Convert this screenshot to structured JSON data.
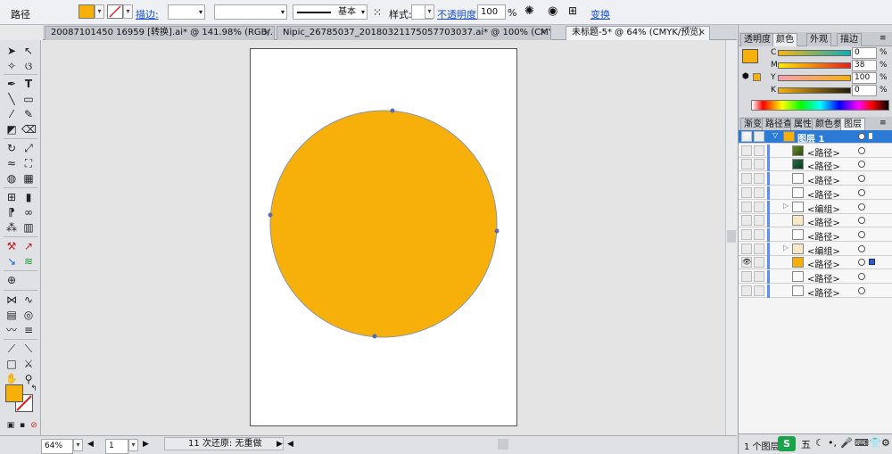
{
  "colors": {
    "fill": "#f7b00a",
    "accent": "#2a7ad6",
    "selection": "#2f59c6"
  },
  "control_bar": {
    "object_type": "路径",
    "stroke_label": "描边:",
    "stroke_profile": "基本",
    "style_label": "样式:",
    "opacity_label": "不透明度:",
    "opacity_value": "100",
    "opacity_unit": "%",
    "transform_label": "变换"
  },
  "tabs": [
    {
      "label": "20087101450 16959 [转换].ai* @ 141.98% (RGB/...",
      "close": "×"
    },
    {
      "label": "Nipic_26785037_20180321175057703037.ai* @ 100% (CMYK/...",
      "close": "×"
    },
    {
      "label": "未标题-5* @ 64% (CMYK/预览)",
      "close": "×"
    }
  ],
  "status_bar": {
    "zoom": "64%",
    "artboard_num": "1",
    "info": "11 次还原: 无重做"
  },
  "color_panel": {
    "tabs": [
      "透明度",
      "颜色",
      "外观",
      "描边"
    ],
    "channels": [
      {
        "label": "C",
        "value": "0",
        "unit": "%"
      },
      {
        "label": "M",
        "value": "38",
        "unit": "%"
      },
      {
        "label": "Y",
        "value": "100",
        "unit": "%"
      },
      {
        "label": "K",
        "value": "0",
        "unit": "%"
      }
    ]
  },
  "layers_panel": {
    "tabs": [
      "渐变",
      "路径查",
      "属性",
      "颜色参",
      "图层"
    ],
    "rows": [
      {
        "name": "图层 1",
        "expand": "▽",
        "visible": true,
        "top": true
      },
      {
        "name": "<路径>",
        "expand": "",
        "visible": false
      },
      {
        "name": "<路径>",
        "expand": "",
        "visible": false
      },
      {
        "name": "<路径>",
        "expand": "",
        "visible": false
      },
      {
        "name": "<路径>",
        "expand": "",
        "visible": false
      },
      {
        "name": "<编组>",
        "expand": "▷",
        "visible": false
      },
      {
        "name": "<路径>",
        "expand": "",
        "visible": false
      },
      {
        "name": "<路径>",
        "expand": "",
        "visible": false
      },
      {
        "name": "<编组>",
        "expand": "▷",
        "visible": false
      },
      {
        "name": "<路径>",
        "expand": "",
        "visible": true,
        "selected": true
      },
      {
        "name": "<路径>",
        "expand": "",
        "visible": false
      },
      {
        "name": "<路径>",
        "expand": "",
        "visible": false
      }
    ],
    "footer": "1 个图层"
  },
  "ime_bar": {
    "mode": "五"
  }
}
